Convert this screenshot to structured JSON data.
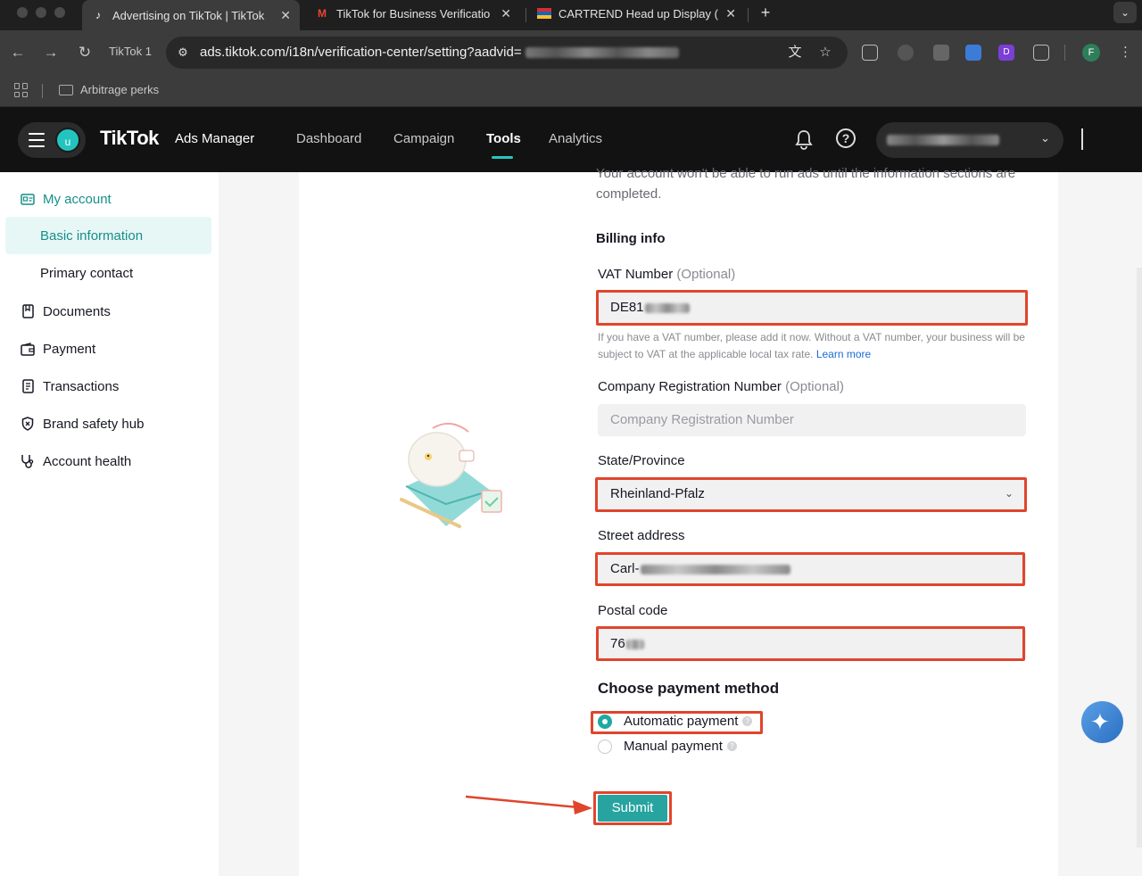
{
  "browser": {
    "tabs": [
      {
        "title": "Advertising on TikTok | TikTok",
        "favicon": "tiktok-icon",
        "active": true
      },
      {
        "title": "TikTok for Business Verificatio",
        "favicon": "gmail-icon",
        "active": false
      },
      {
        "title": "CARTREND Head up Display (",
        "favicon": "flag-icon",
        "active": false
      }
    ],
    "profile_chip": "TikTok 1",
    "url": "ads.tiktok.com/i18n/verification-center/setting?aadvid=",
    "bookmark_folder": "Arbitrage perks",
    "avatar_letter": "F"
  },
  "header": {
    "brand": "TikTok",
    "brand_sub": "Ads Manager",
    "user_initial": "u",
    "nav": [
      "Dashboard",
      "Campaign",
      "Tools",
      "Analytics"
    ],
    "active_nav": "Tools"
  },
  "sidebar": {
    "items": [
      {
        "label": "My account",
        "icon": "id-card-icon"
      },
      {
        "label": "Basic information"
      },
      {
        "label": "Primary contact"
      },
      {
        "label": "Documents",
        "icon": "bookmark-icon"
      },
      {
        "label": "Payment",
        "icon": "wallet-icon"
      },
      {
        "label": "Transactions",
        "icon": "receipt-icon"
      },
      {
        "label": "Brand safety hub",
        "icon": "shield-icon"
      },
      {
        "label": "Account health",
        "icon": "stethoscope-icon"
      }
    ]
  },
  "form": {
    "intro": "Your account won't be able to run ads until the information sections are completed.",
    "billing_title": "Billing info",
    "vat_label": "VAT Number",
    "optional": "(Optional)",
    "vat_value": "DE81",
    "vat_help": "If you have a VAT number, please add it now. Without a VAT number, your business will be subject to VAT at the applicable local tax rate.",
    "learn_more": "Learn more",
    "crn_label": "Company Registration Number",
    "crn_placeholder": "Company Registration Number",
    "state_label": "State/Province",
    "state_value": "Rheinland-Pfalz",
    "street_label": "Street address",
    "street_value": "Carl-",
    "postal_label": "Postal code",
    "postal_value": "76",
    "payment_title": "Choose payment method",
    "payment_options": [
      "Automatic payment",
      "Manual payment"
    ],
    "selected_payment": "Automatic payment",
    "submit_label": "Submit"
  },
  "colors": {
    "accent": "#27a3a0",
    "highlight": "#e0452c",
    "header_bg": "#121212"
  }
}
